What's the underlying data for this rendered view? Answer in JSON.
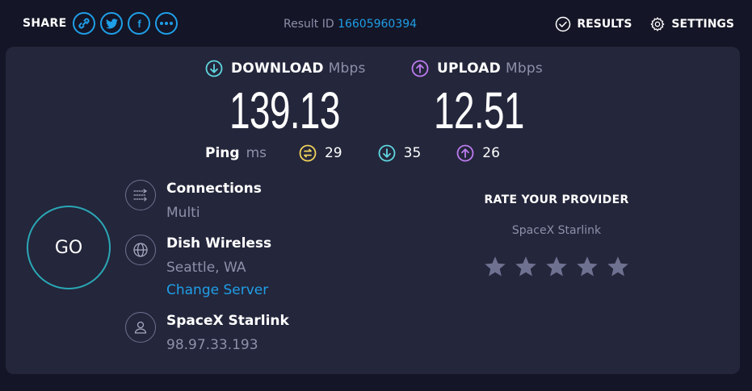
{
  "header": {
    "share_label": "SHARE",
    "share_icons": [
      "link-icon",
      "twitter-icon",
      "facebook-icon",
      "more-icon"
    ],
    "facebook_glyph": "f",
    "result_id_label": "Result ID",
    "result_id_value": "16605960394",
    "results_label": "RESULTS",
    "settings_label": "SETTINGS"
  },
  "speeds": {
    "download": {
      "label": "DOWNLOAD",
      "unit": "Mbps",
      "value": "139.13"
    },
    "upload": {
      "label": "UPLOAD",
      "unit": "Mbps",
      "value": "12.51"
    }
  },
  "ping": {
    "label": "Ping",
    "unit": "ms",
    "idle": "29",
    "download": "35",
    "upload": "26"
  },
  "go_label": "GO",
  "connection": {
    "connections_title": "Connections",
    "connections_value": "Multi",
    "server_title": "Dish Wireless",
    "server_location": "Seattle, WA",
    "change_server_label": "Change Server",
    "isp_title": "SpaceX Starlink",
    "ip_address": "98.97.33.193"
  },
  "rate": {
    "title": "RATE YOUR PROVIDER",
    "provider": "SpaceX Starlink",
    "stars": 5,
    "selected_stars": 0
  },
  "colors": {
    "accent_blue": "#1f9fe8",
    "download_teal": "#5fd7e0",
    "upload_purple": "#bc7cf0",
    "ping_yellow": "#f0d35c",
    "go_ring": "#2aa7b5",
    "card_bg": "#24263b",
    "page_bg": "#141526"
  }
}
